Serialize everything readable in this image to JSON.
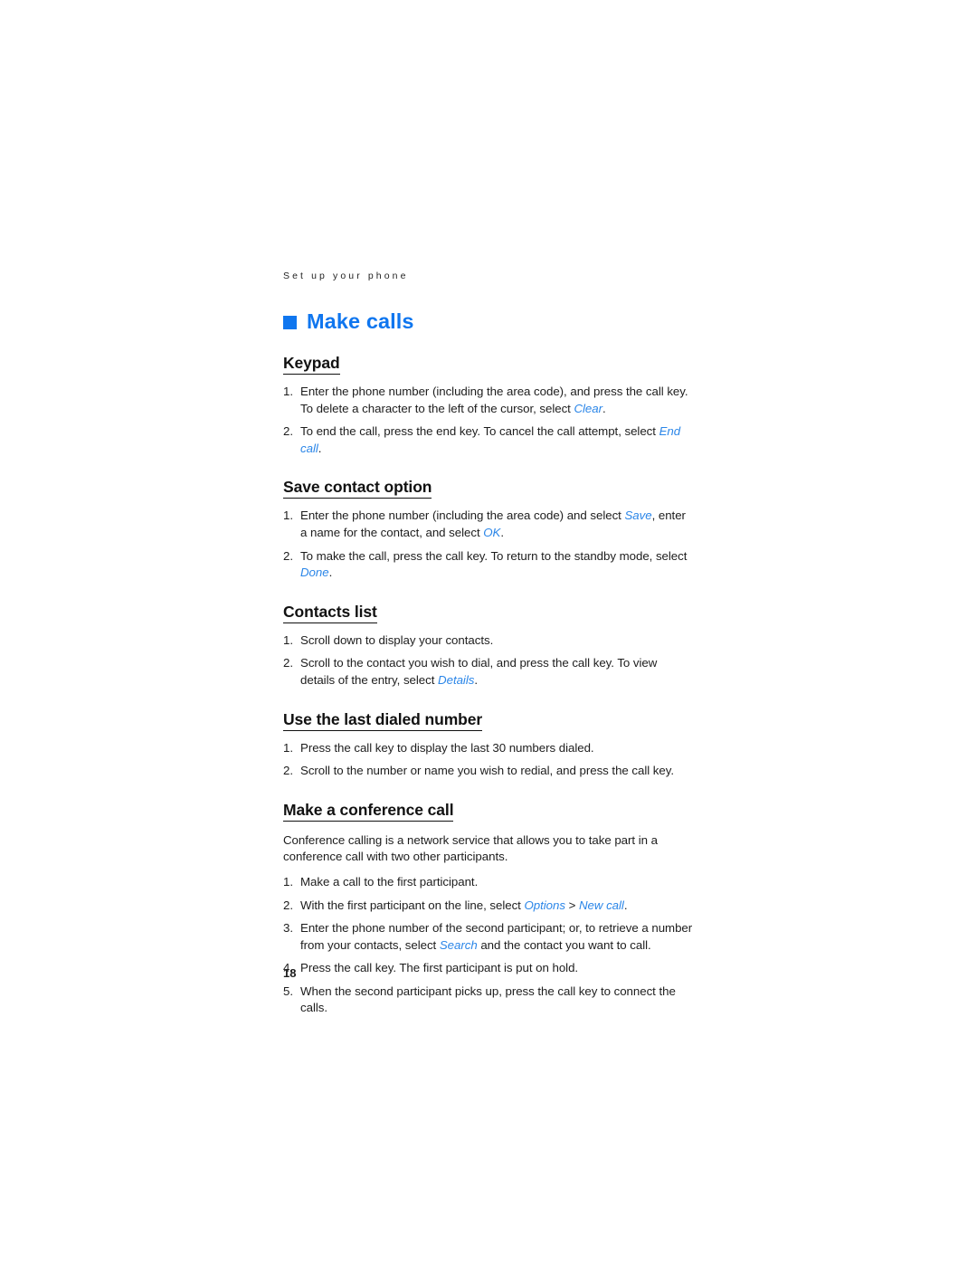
{
  "page": {
    "running_header": "Set up your phone",
    "page_number": "18",
    "accent_color": "#0f76ef",
    "ui_term_color": "#2b86e8",
    "body_color": "#1d1d1d"
  },
  "chapter": {
    "bullet_icon": "blue-square-bullet",
    "title": "Make calls"
  },
  "sections": [
    {
      "heading": "Keypad",
      "paragraph": "",
      "steps": [
        {
          "num": "1.",
          "parts": [
            {
              "text": "Enter the phone number (including the area code), and press the call key. To delete a character to the left of the cursor, select ",
              "style": "plain"
            },
            {
              "text": "Clear",
              "style": "ui"
            },
            {
              "text": ".",
              "style": "plain"
            }
          ]
        },
        {
          "num": "2.",
          "parts": [
            {
              "text": "To end the call, press the end key. To cancel the call attempt, select ",
              "style": "plain"
            },
            {
              "text": "End call",
              "style": "ui"
            },
            {
              "text": ".",
              "style": "plain"
            }
          ]
        }
      ]
    },
    {
      "heading": "Save contact option",
      "paragraph": "",
      "steps": [
        {
          "num": "1.",
          "parts": [
            {
              "text": "Enter the phone number (including the area code) and select ",
              "style": "plain"
            },
            {
              "text": "Save",
              "style": "ui"
            },
            {
              "text": ", enter a name for the contact, and select ",
              "style": "plain"
            },
            {
              "text": "OK",
              "style": "ui"
            },
            {
              "text": ".",
              "style": "plain"
            }
          ]
        },
        {
          "num": "2.",
          "parts": [
            {
              "text": "To make the call, press the call key. To return to the standby mode, select ",
              "style": "plain"
            },
            {
              "text": "Done",
              "style": "ui"
            },
            {
              "text": ".",
              "style": "plain"
            }
          ]
        }
      ]
    },
    {
      "heading": "Contacts list",
      "paragraph": "",
      "steps": [
        {
          "num": "1.",
          "parts": [
            {
              "text": "Scroll down to display your contacts.",
              "style": "plain"
            }
          ]
        },
        {
          "num": "2.",
          "parts": [
            {
              "text": "Scroll to the contact you wish to dial, and press the call key. To view details of the entry, select ",
              "style": "plain"
            },
            {
              "text": "Details",
              "style": "ui"
            },
            {
              "text": ".",
              "style": "plain"
            }
          ]
        }
      ]
    },
    {
      "heading": "Use the last dialed number",
      "paragraph": "",
      "steps": [
        {
          "num": "1.",
          "parts": [
            {
              "text": "Press the call key to display the last 30 numbers dialed.",
              "style": "plain"
            }
          ]
        },
        {
          "num": "2.",
          "parts": [
            {
              "text": "Scroll to the number or name you wish to redial, and press the call key.",
              "style": "plain"
            }
          ]
        }
      ]
    },
    {
      "heading": "Make a conference call",
      "paragraph": "Conference calling is a network service that allows you to take part in a conference call with two other participants.",
      "steps": [
        {
          "num": "1.",
          "parts": [
            {
              "text": "Make a call to the first participant.",
              "style": "plain"
            }
          ]
        },
        {
          "num": "2.",
          "parts": [
            {
              "text": "With the first participant on the line, select ",
              "style": "plain"
            },
            {
              "text": "Options",
              "style": "ui"
            },
            {
              "text": " > ",
              "style": "plain"
            },
            {
              "text": "New call",
              "style": "ui"
            },
            {
              "text": ".",
              "style": "plain"
            }
          ]
        },
        {
          "num": "3.",
          "parts": [
            {
              "text": "Enter the phone number of the second participant; or, to retrieve a number from your contacts, select ",
              "style": "plain"
            },
            {
              "text": "Search",
              "style": "ui"
            },
            {
              "text": " and the contact you want to call.",
              "style": "plain"
            }
          ]
        },
        {
          "num": "4.",
          "parts": [
            {
              "text": "Press the call key. The first participant is put on hold.",
              "style": "plain"
            }
          ]
        },
        {
          "num": "5.",
          "parts": [
            {
              "text": "When the second participant picks up, press the call key to connect the calls.",
              "style": "plain"
            }
          ]
        }
      ]
    }
  ]
}
